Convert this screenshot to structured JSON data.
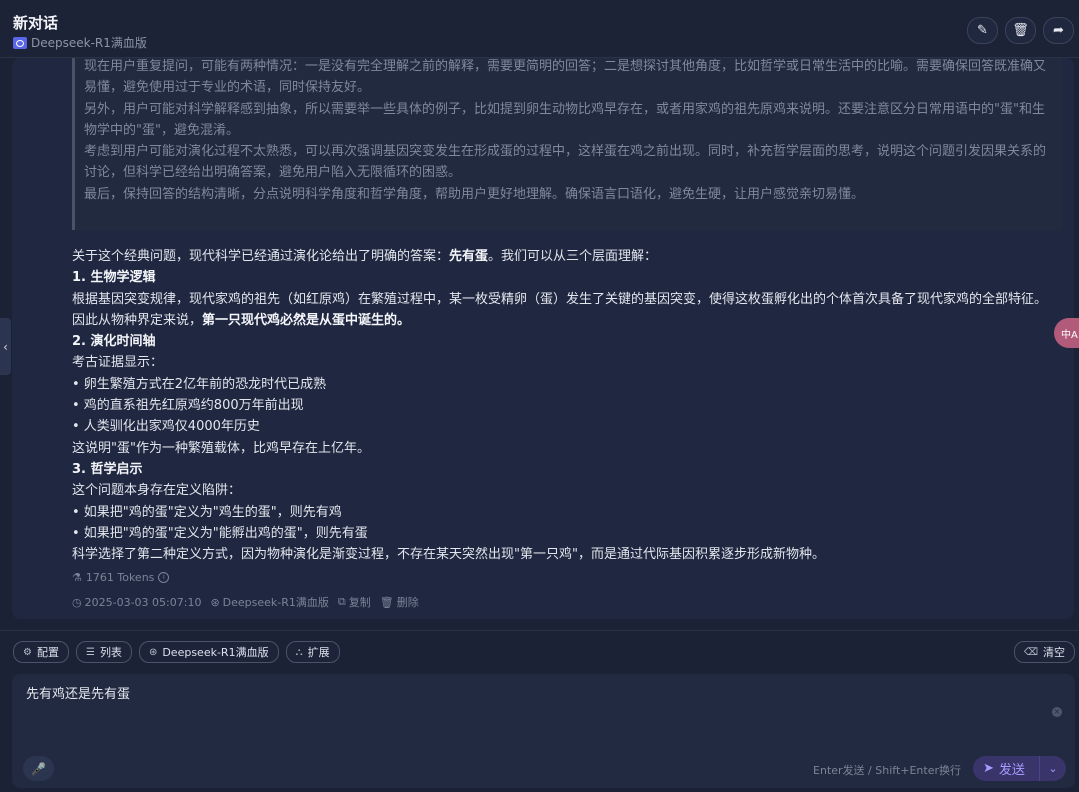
{
  "header": {
    "title": "新对话",
    "model": "Deepseek-R1满血版",
    "buttons": [
      "edit-icon",
      "trash-icon",
      "share-icon"
    ]
  },
  "thinking": {
    "lines": [
      "现在用户重复提问，可能有两种情况：一是没有完全理解之前的解释，需要更简明的回答；二是想探讨其他角度，比如哲学或日常生活中的比喻。需要确保回答既准确又易懂，避免使用过于专业的术语，同时保持友好。",
      "另外，用户可能对科学解释感到抽象，所以需要举一些具体的例子，比如提到卵生动物比鸡早存在，或者用家鸡的祖先原鸡来说明。还要注意区分日常用语中的\"蛋\"和生物学中的\"蛋\"，避免混淆。",
      "考虑到用户可能对演化过程不太熟悉，可以再次强调基因突变发生在形成蛋的过程中，这样蛋在鸡之前出现。同时，补充哲学层面的思考，说明这个问题引发因果关系的讨论，但科学已经给出明确答案，避免用户陷入无限循环的困惑。",
      "最后，保持回答的结构清晰，分点说明科学角度和哲学角度，帮助用户更好地理解。确保语言口语化，避免生硬，让用户感觉亲切易懂。"
    ]
  },
  "answer": {
    "intro_prefix": "关于这个经典问题，现代科学已经通过演化论给出了明确的答案：",
    "intro_bold": "先有蛋",
    "intro_suffix": "。我们可以从三个层面理解：",
    "s1_title": "1. 生物学逻辑",
    "s1_text": "根据基因突变规律，现代家鸡的祖先（如红原鸡）在繁殖过程中，某一枚受精卵（蛋）发生了关键的基因突变，使得这枚蛋孵化出的个体首次具备了现代家鸡的全部特征。因此从物种界定来说，",
    "s1_bold": "第一只现代鸡必然是从蛋中诞生的。",
    "s2_title": "2. 演化时间轴",
    "s2_lead": "考古证据显示：",
    "s2_items": [
      "• 卵生繁殖方式在2亿年前的恐龙时代已成熟",
      "• 鸡的直系祖先红原鸡约800万年前出现",
      "• 人类驯化出家鸡仅4000年历史"
    ],
    "s2_tail": "这说明\"蛋\"作为一种繁殖载体，比鸡早存在上亿年。",
    "s3_title": "3. 哲学启示",
    "s3_lead": "这个问题本身存在定义陷阱：",
    "s3_items": [
      "• 如果把\"鸡的蛋\"定义为\"鸡生的蛋\"，则先有鸡",
      "• 如果把\"鸡的蛋\"定义为\"能孵出鸡的蛋\"，则先有蛋"
    ],
    "s3_tail": "科学选择了第二种定义方式，因为物种演化是渐变过程，不存在某天突然出现\"第一只鸡\"，而是通过代际基因积累逐步形成新物种。"
  },
  "meta": {
    "tokens": "1761 Tokens",
    "timestamp": "2025-03-03 05:07:10",
    "model": "Deepseek-R1满血版",
    "copy": "复制",
    "delete": "删除"
  },
  "toolbar": {
    "config": "配置",
    "list": "列表",
    "model": "Deepseek-R1满血版",
    "extend": "扩展",
    "clear": "清空"
  },
  "input": {
    "value": "先有鸡还是先有蛋",
    "hint": "Enter发送 / Shift+Enter换行",
    "send": "发送"
  },
  "floating": {
    "translate": "中A"
  },
  "colors": {
    "background": "#1b2236",
    "card": "#1f2741",
    "accent": "#a79cff",
    "translate_fab": "#b15a7a"
  }
}
